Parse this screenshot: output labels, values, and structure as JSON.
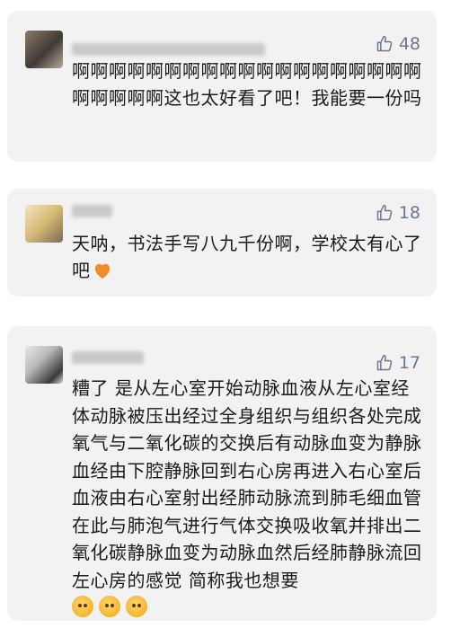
{
  "comments": [
    {
      "username": "████████████",
      "likes": "48",
      "text": "啊啊啊啊啊啊啊啊啊啊啊啊啊啊啊啊啊啊啊啊啊啊啊啊这也太好看了吧！我能要一份吗"
    },
    {
      "username": "██",
      "likes": "18",
      "text": "天呐，书法手写八九千份啊，学校太有心了吧",
      "emoji": "orange-heart-emoji"
    },
    {
      "username": "█████",
      "likes": "17",
      "text": "糟了 是从左心室开始动脉血液从左心室经体动脉被压出经过全身组织与组织各处完成氧气与二氧化碳的交换后有动脉血变为静脉血经由下腔静脉回到右心房再进入右心室后血液由右心室射出经肺动脉流到肺毛细血管在此与肺泡气进行气体交换吸收氧并排出二氧化碳静脉血变为动脉血然后经肺静脉流回左心房的感觉 简称我也想要",
      "emoji": "pleading-face-emoji x3"
    }
  ],
  "colors": {
    "card_background": "#f2f2f2",
    "like_color": "#6c7793",
    "text_color": "#1a1a1a"
  },
  "icons": {
    "like": "thumbs-up-outline-icon"
  }
}
